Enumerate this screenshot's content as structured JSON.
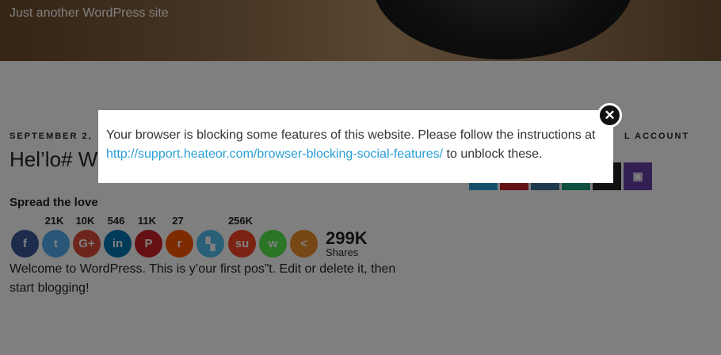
{
  "site": {
    "tagline": "Just another WordPress site"
  },
  "post": {
    "date": "SEPTEMBER 2,",
    "title": "Hel’lo# W",
    "content": "Welcome to WordPress. This is y’our first pos”t. Edit or delete it, then start blogging!"
  },
  "share": {
    "heading": "Spread the love",
    "buttons": [
      {
        "icon": "facebook-icon",
        "glyph": "f",
        "color": "#3b5998",
        "count": ""
      },
      {
        "icon": "twitter-icon",
        "glyph": "t",
        "color": "#55acee",
        "count": "21K"
      },
      {
        "icon": "google-plus-icon",
        "glyph": "G+",
        "color": "#dd4b39",
        "count": "10K"
      },
      {
        "icon": "linkedin-icon",
        "glyph": "in",
        "color": "#0077b5",
        "count": "546"
      },
      {
        "icon": "pinterest-icon",
        "glyph": "P",
        "color": "#cb2027",
        "count": "11K"
      },
      {
        "icon": "reddit-icon",
        "glyph": "r",
        "color": "#ff5700",
        "count": "27"
      },
      {
        "icon": "delicious-icon",
        "glyph": "▚",
        "color": "#53beee",
        "count": ""
      },
      {
        "icon": "stumbleupon-icon",
        "glyph": "su",
        "color": "#f74425",
        "count": "256K"
      },
      {
        "icon": "whatsapp-icon",
        "glyph": "w",
        "color": "#55eb4c",
        "count": ""
      },
      {
        "icon": "share-more-icon",
        "glyph": "<",
        "color": "#ee8e2d",
        "count": ""
      }
    ],
    "total": "299K",
    "total_label": "Shares"
  },
  "sidebar": {
    "widget_title": "L ACCOUNT",
    "social_icons": [
      {
        "icon": "social-icon-1",
        "color": "#2a9fd6",
        "glyph": ""
      },
      {
        "icon": "social-icon-2",
        "color": "#cb2027",
        "glyph": ""
      },
      {
        "icon": "instagram-icon",
        "color": "#3f729b",
        "glyph": ""
      },
      {
        "icon": "social-icon-4",
        "color": "#1b9e82",
        "glyph": ""
      },
      {
        "icon": "flickr-icon",
        "color": "#222222",
        "glyph": "◉"
      },
      {
        "icon": "twitch-icon",
        "color": "#6441a5",
        "glyph": "▣"
      }
    ]
  },
  "modal": {
    "text_before": "Your browser is blocking some features of this website. Please follow the instructions at ",
    "link": "http://support.heateor.com/browser-blocking-social-features/",
    "text_after": " to unblock these.",
    "close_glyph": "✕"
  }
}
